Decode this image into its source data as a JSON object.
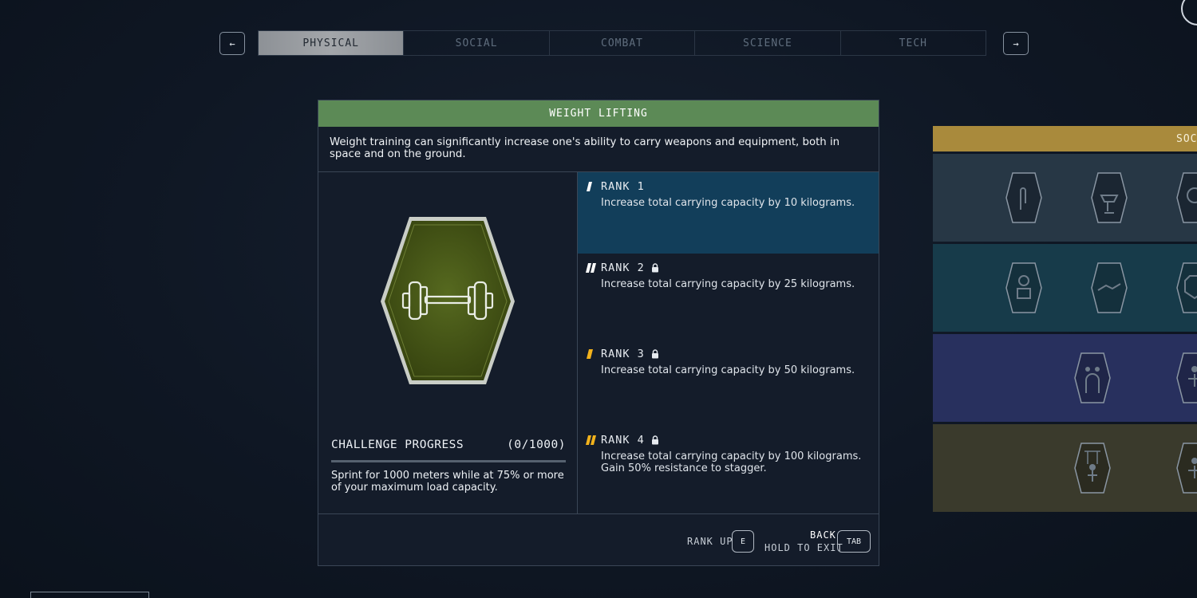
{
  "nav": {
    "prev_label": "←",
    "next_label": "→",
    "tabs": [
      "PHYSICAL",
      "SOCIAL",
      "COMBAT",
      "SCIENCE",
      "TECH"
    ],
    "active_tab": "PHYSICAL"
  },
  "skill": {
    "title": "WEIGHT LIFTING",
    "description": "Weight training can significantly increase one's ability to carry weapons and equipment, both in space and on the ground.",
    "icon": "dumbbell-icon",
    "badge_color": "#4a5a1c"
  },
  "challenge": {
    "label": "CHALLENGE PROGRESS",
    "progress_text": "(0/1000)",
    "progress_value": 0,
    "progress_max": 1000,
    "description": "Sprint for 1000 meters while at 75% or more of your maximum load capacity."
  },
  "ranks": [
    {
      "title": "RANK 1",
      "locked": false,
      "marker_color": "#ffffff",
      "text": "Increase total carrying capacity by 10 kilograms."
    },
    {
      "title": "RANK 2",
      "locked": true,
      "marker_color": "#ffffff",
      "text": "Increase total carrying capacity by 25 kilograms."
    },
    {
      "title": "RANK 3",
      "locked": true,
      "marker_color": "#f2b21c",
      "text": "Increase total carrying capacity by 50 kilograms."
    },
    {
      "title": "RANK 4",
      "locked": true,
      "marker_color": "#f2b21c",
      "text": "Increase total carrying capacity by 100 kilograms. Gain 50% resistance to stagger."
    }
  ],
  "footer": {
    "rank_up_label": "RANK UP",
    "rank_up_key": "E",
    "back_label": "BACK",
    "hold_label": "HOLD TO EXIT",
    "back_key": "TAB"
  },
  "side_panel": {
    "header": "SOCI",
    "header_color": "#a98a3c",
    "rows": [
      {
        "color": "#273745",
        "icons": [
          "hand-icon",
          "fountain-icon",
          "face-icon"
        ]
      },
      {
        "color": "#173b4a",
        "icons": [
          "robot-icon",
          "handshake-icon",
          "beast-icon"
        ]
      },
      {
        "color": "#28305e",
        "icons": [
          "crowd-icon",
          "figure-icon"
        ]
      },
      {
        "color": "#3a3a2c",
        "icons": [
          "puppet-icon",
          "figure-icon"
        ]
      }
    ]
  },
  "colors": {
    "accent_green": "#5c8a56",
    "active_rank_bg": "#123e5a",
    "rank_gold": "#f2b21c"
  }
}
